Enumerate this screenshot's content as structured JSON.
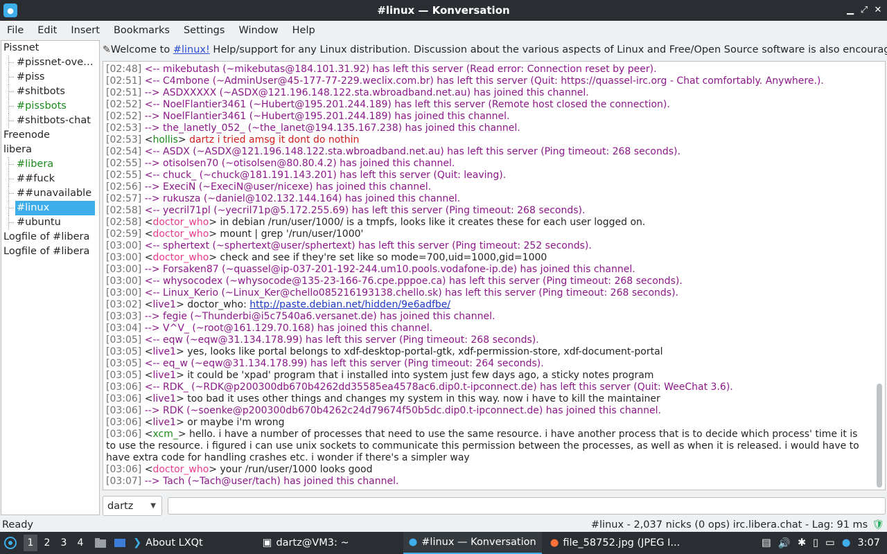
{
  "window": {
    "title": "#linux — Konversation"
  },
  "menu": [
    "File",
    "Edit",
    "Insert",
    "Bookmarks",
    "Settings",
    "Window",
    "Help"
  ],
  "sidebar": {
    "items": [
      {
        "label": "Pissnet",
        "type": "server",
        "color": ""
      },
      {
        "label": "#pissnet-over…",
        "type": "channel",
        "color": ""
      },
      {
        "label": "#piss",
        "type": "channel",
        "color": ""
      },
      {
        "label": "#shitbots",
        "type": "channel",
        "color": ""
      },
      {
        "label": "#pissbots",
        "type": "channel",
        "color": "green"
      },
      {
        "label": "#shitbots-chat",
        "type": "channel",
        "color": ""
      },
      {
        "label": "Freenode",
        "type": "server",
        "color": ""
      },
      {
        "label": "libera",
        "type": "server",
        "color": ""
      },
      {
        "label": "#libera",
        "type": "channel",
        "color": "green"
      },
      {
        "label": "##fuck",
        "type": "channel",
        "color": ""
      },
      {
        "label": "##unavailable",
        "type": "channel",
        "color": ""
      },
      {
        "label": "#linux",
        "type": "channel",
        "color": "",
        "selected": true
      },
      {
        "label": "#ubuntu",
        "type": "channel",
        "color": ""
      },
      {
        "label": "Logfile of #libera",
        "type": "server",
        "color": ""
      },
      {
        "label": "Logfile of #libera",
        "type": "server",
        "color": ""
      }
    ]
  },
  "topic": {
    "prefix": "Welcome to ",
    "channel": "#linux!",
    "rest": " Help/support for any Linux distribution. Discussion about the various aspects of Linux and Free/Open Source software is also encouraged. ..."
  },
  "chat": [
    {
      "ts": "[02:48]",
      "kind": "part",
      "text": "<-- mikebutash (~mikebutas@184.101.31.92) has left this server (Read error: Connection reset by peer)."
    },
    {
      "ts": "[02:51]",
      "kind": "part",
      "text": "<-- C4mbone (~AdminUser@45-177-77-229.weclix.com.br) has left this server (Quit: https://quassel-irc.org - Chat comfortably. Anywhere.)."
    },
    {
      "ts": "[02:51]",
      "kind": "join",
      "text": "--> ASDXXXXX (~ASDX@121.196.148.122.sta.wbroadband.net.au) has joined this channel."
    },
    {
      "ts": "[02:52]",
      "kind": "part",
      "text": "<-- NoelFlantier3461 (~Hubert@195.201.244.189) has left this server (Remote host closed the connection)."
    },
    {
      "ts": "[02:52]",
      "kind": "join",
      "text": "--> NoelFlantier3461 (~Hubert@195.201.244.189) has joined this channel."
    },
    {
      "ts": "[02:53]",
      "kind": "join",
      "text": "--> the_lanetly_052_ (~the_lanet@194.135.167.238) has joined this channel."
    },
    {
      "ts": "[02:53]",
      "kind": "msg",
      "nick": "hollis",
      "nickclass": "nick-hollis",
      "text": "dartz i tried amsg it dont do nothin",
      "textclass": "red"
    },
    {
      "ts": "[02:54]",
      "kind": "part",
      "text": "<-- ASDX (~ASDX@121.196.148.122.sta.wbroadband.net.au) has left this server (Ping timeout: 268 seconds)."
    },
    {
      "ts": "[02:55]",
      "kind": "join",
      "text": "--> otisolsen70 (~otisolsen@80.80.4.2) has joined this channel."
    },
    {
      "ts": "[02:55]",
      "kind": "part",
      "text": "<-- chuck_ (~chuck@181.191.143.201) has left this server (Quit: leaving)."
    },
    {
      "ts": "[02:56]",
      "kind": "join",
      "text": "--> ExeciN (~ExeciN@user/nicexe) has joined this channel."
    },
    {
      "ts": "[02:57]",
      "kind": "join",
      "text": "--> rukusza (~daniel@102.132.144.164) has joined this channel."
    },
    {
      "ts": "[02:58]",
      "kind": "part",
      "text": "<-- yecril71pl (~yecril71p@5.172.255.69) has left this server (Ping timeout: 268 seconds)."
    },
    {
      "ts": "[02:58]",
      "kind": "msg",
      "nick": "doctor_who",
      "nickclass": "nick-doctor",
      "text": "in debian /run/user/1000/ is a tmpfs, looks like it creates these for each user logged on.",
      "textclass": ""
    },
    {
      "ts": "[02:59]",
      "kind": "msg",
      "nick": "doctor_who",
      "nickclass": "nick-doctor",
      "text": "mount | grep '/run/user/1000'",
      "textclass": ""
    },
    {
      "ts": "[03:00]",
      "kind": "part",
      "text": "<-- sphertext (~sphertext@user/sphertext) has left this server (Ping timeout: 252 seconds)."
    },
    {
      "ts": "[03:00]",
      "kind": "msg",
      "nick": "doctor_who",
      "nickclass": "nick-doctor",
      "text": "check and see if they're set like so mode=700,uid=1000,gid=1000",
      "textclass": ""
    },
    {
      "ts": "[03:00]",
      "kind": "join",
      "text": "--> Forsaken87 (~quassel@ip-037-201-192-244.um10.pools.vodafone-ip.de) has joined this channel."
    },
    {
      "ts": "[03:00]",
      "kind": "part",
      "text": "<-- whysocodex (~whysocode@135-23-166-76.cpe.pppoe.ca) has left this server (Ping timeout: 268 seconds)."
    },
    {
      "ts": "[03:00]",
      "kind": "part",
      "text": "<-- Linux_Kerio (~Linux_Ker@chello085216193138.chello.sk) has left this server (Ping timeout: 268 seconds)."
    },
    {
      "ts": "[03:02]",
      "kind": "msg",
      "nick": "live1",
      "nickclass": "nick-live",
      "text": "doctor_who: ",
      "link": "http://paste.debian.net/hidden/9e6adfbe/",
      "textclass": ""
    },
    {
      "ts": "[03:03]",
      "kind": "join",
      "text": "--> fegie (~Thunderbi@i5c7540a6.versanet.de) has joined this channel."
    },
    {
      "ts": "[03:04]",
      "kind": "join",
      "text": "--> V^V_ (~root@161.129.70.168) has joined this channel."
    },
    {
      "ts": "[03:05]",
      "kind": "part",
      "text": "<-- eqw (~eqw@31.134.178.99) has left this server (Ping timeout: 268 seconds)."
    },
    {
      "ts": "[03:05]",
      "kind": "msg",
      "nick": "live1",
      "nickclass": "nick-live",
      "text": "yes, looks like portal belongs to xdf-desktop-portal-gtk, xdf-permission-store, xdf-document-portal",
      "textclass": ""
    },
    {
      "ts": "[03:05]",
      "kind": "part",
      "text": "<-- eq_w (~eqw@31.134.178.99) has left this server (Ping timeout: 264 seconds)."
    },
    {
      "ts": "[03:05]",
      "kind": "msg",
      "nick": "live1",
      "nickclass": "nick-live",
      "text": "it could be 'xpad' program that i installed into system just few days ago, a sticky notes program",
      "textclass": ""
    },
    {
      "ts": "[03:06]",
      "kind": "part",
      "text": "<-- RDK_ (~RDK@p200300db670b4262dd35585ea4578ac6.dip0.t-ipconnect.de) has left this server (Quit: WeeChat 3.6)."
    },
    {
      "ts": "[03:06]",
      "kind": "msg",
      "nick": "live1",
      "nickclass": "nick-live",
      "text": "too bad it uses other things and changes my system in this way. now i have to kill the maintainer",
      "textclass": ""
    },
    {
      "ts": "[03:06]",
      "kind": "join",
      "text": "--> RDK (~soenke@p200300db670b4262c24d79674f50b5dc.dip0.t-ipconnect.de) has joined this channel."
    },
    {
      "ts": "[03:06]",
      "kind": "msg",
      "nick": "live1",
      "nickclass": "nick-live",
      "text": "or maybe i'm wrong",
      "textclass": ""
    },
    {
      "ts": "[03:06]",
      "kind": "msg",
      "nick": "xcm_",
      "nickclass": "nick-xcm",
      "text": "hello. i have a number of processes that need to use the same resource. i have another process that is to decide which process' time it is to use the resource. i figured i can use unix sockets to communicate this permission between the processes, as well as when it is released. i would have to have extra code for handling crashes etc. i wonder if there's a simpler way",
      "textclass": ""
    },
    {
      "ts": "[03:06]",
      "kind": "msg",
      "nick": "doctor_who",
      "nickclass": "nick-doctor",
      "text": "your /run/user/1000 looks good",
      "textclass": ""
    },
    {
      "ts": "[03:07]",
      "kind": "join",
      "text": "--> Tach (~Tach@user/tach) has joined this channel."
    }
  ],
  "input": {
    "nick": "dartz",
    "message": ""
  },
  "status": {
    "left": "Ready",
    "right": "#linux - 2,037 nicks (0 ops)  irc.libera.chat - Lag: 91 ms"
  },
  "taskbar": {
    "desktops": [
      "1",
      "2",
      "3",
      "4"
    ],
    "tasks": [
      "About LXQt",
      "dartz@VM3: ~",
      "#linux — Konversation",
      "file_58752.jpg (JPEG I..."
    ],
    "clock": "3:07"
  },
  "colors": {
    "accent": "#3daee9",
    "join": "#8b1889",
    "timestamp": "#707070",
    "taskbar": "#2a2e32"
  }
}
